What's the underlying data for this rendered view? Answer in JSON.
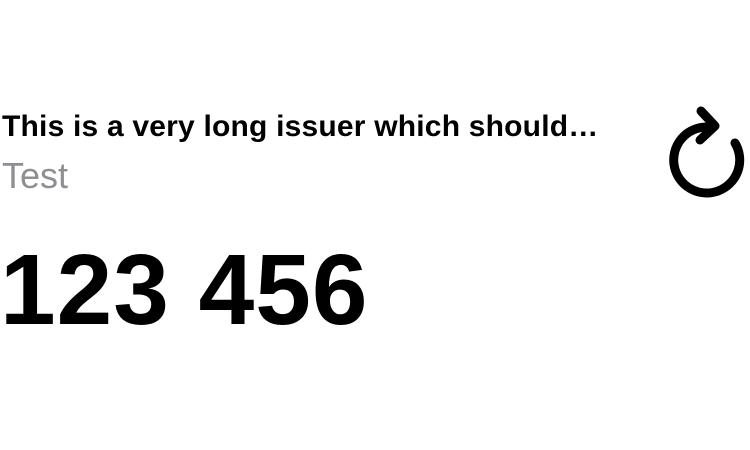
{
  "token": {
    "issuer": "This is a very long issuer which should…",
    "account": "Test",
    "code": "123 456"
  },
  "icons": {
    "refresh": "refresh-icon"
  },
  "colors": {
    "background": "#ffffff",
    "primary_text": "#000000",
    "secondary_text": "#8e8e93"
  }
}
